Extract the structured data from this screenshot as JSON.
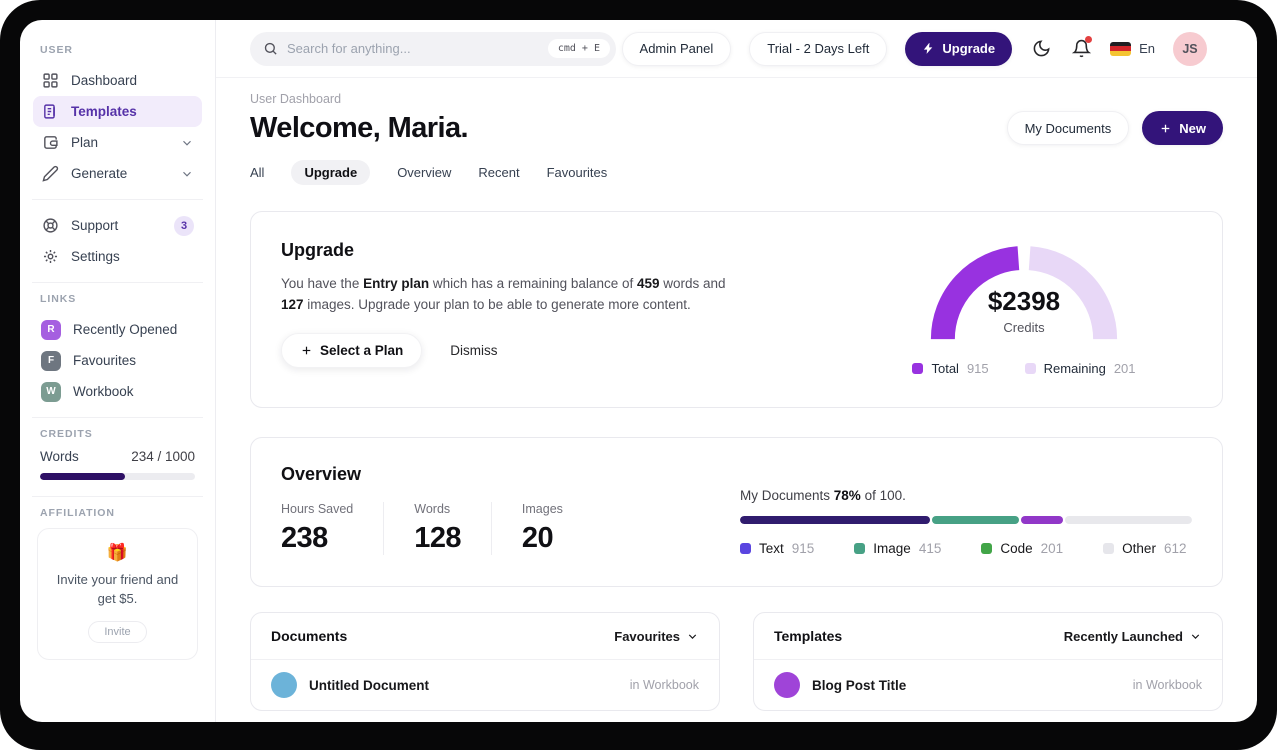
{
  "sidebar": {
    "user_label": "USER",
    "items": [
      {
        "label": "Dashboard"
      },
      {
        "label": "Templates"
      },
      {
        "label": "Plan"
      },
      {
        "label": "Generate"
      }
    ],
    "support_label": "Support",
    "support_badge": "3",
    "settings_label": "Settings",
    "links_label": "LINKS",
    "links": [
      {
        "initial": "R",
        "label": "Recently Opened",
        "color": "#a55fe0"
      },
      {
        "initial": "F",
        "label": "Favourites",
        "color": "#6e7680"
      },
      {
        "initial": "W",
        "label": "Workbook",
        "color": "#7c9c92"
      }
    ],
    "credits_label": "CREDITS",
    "credits": {
      "label": "Words",
      "value": "234 / 1000",
      "fill_pct": 55
    },
    "affiliation_label": "AFFILIATION",
    "affiliation": {
      "emoji": "🎁",
      "text": "Invite your friend and get $5.",
      "button": "Invite"
    }
  },
  "topbar": {
    "search_placeholder": "Search for anything...",
    "search_shortcut": "cmd + E",
    "admin_panel": "Admin Panel",
    "trial": "Trial - 2 Days Left",
    "upgrade_label": "Upgrade",
    "language": "En",
    "avatar_initials": "JS"
  },
  "header": {
    "breadcrumb": "User Dashboard",
    "title": "Welcome, Maria.",
    "my_documents": "My Documents",
    "new_label": "New",
    "tabs": [
      "All",
      "Upgrade",
      "Overview",
      "Recent",
      "Favourites"
    ],
    "active_tab": "Upgrade"
  },
  "upgrade_card": {
    "title": "Upgrade",
    "body": [
      "You have the ",
      "Entry plan",
      " which has a remaining balance of ",
      "459",
      " words and ",
      "127",
      " images. Upgrade your plan to be able to generate more content."
    ],
    "select_plan": "Select a Plan",
    "dismiss": "Dismiss"
  },
  "overview_card": {
    "title": "Overview",
    "stats": [
      {
        "label": "Hours Saved",
        "value": "238"
      },
      {
        "label": "Words",
        "value": "128"
      },
      {
        "label": "Images",
        "value": "20"
      }
    ],
    "docs_line": {
      "prefix": "My Documents ",
      "bold": "78%",
      "suffix": " of 100."
    }
  },
  "documents_card": {
    "title": "Documents",
    "filter": "Favourites",
    "row": {
      "title": "Untitled Document",
      "meta": "in Workbook",
      "color": "#6cb3d9"
    }
  },
  "templates_card": {
    "title": "Templates",
    "filter": "Recently Launched",
    "row": {
      "title": "Blog Post Title",
      "meta": "in Workbook",
      "color": "#9f44d8"
    }
  },
  "chart_data": [
    {
      "type": "pie",
      "style": "half-donut-gauge",
      "title": "Credits gauge",
      "center_text": "$2398",
      "caption": "Credits",
      "labels": [
        "Total",
        "Remaining"
      ],
      "values": [
        915,
        201
      ],
      "colors": [
        "#9832e0",
        "#e8d8f7"
      ],
      "legend_position": "bottom"
    },
    {
      "type": "bar",
      "style": "stacked-progress",
      "title": "My Documents usage",
      "annotation": "My Documents 78% of 100.",
      "categories": [
        "Text",
        "Image",
        "Code",
        "Other"
      ],
      "values": [
        915,
        415,
        201,
        612
      ],
      "bar_colors": [
        "#301c6e",
        "#47a185",
        "#9137c8",
        "#e8e8ec"
      ],
      "legend_colors": [
        "#5a45e0",
        "#47a185",
        "#42a548",
        "#e6e6eb"
      ],
      "legend_position": "bottom"
    }
  ]
}
